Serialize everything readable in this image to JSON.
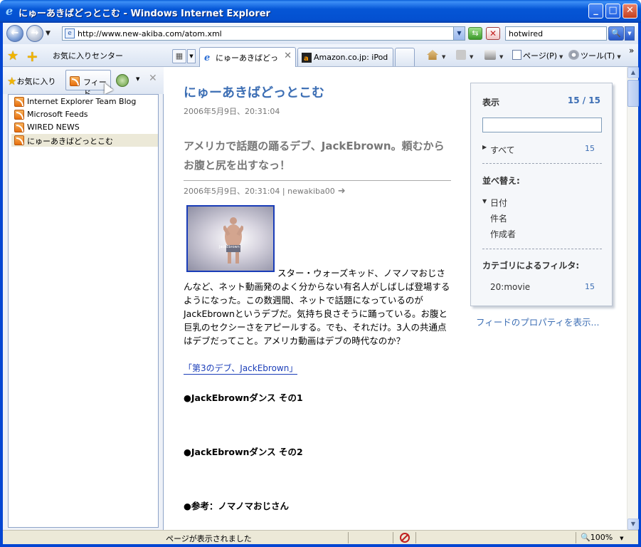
{
  "window": {
    "title": "にゅーあきばどっとこむ - Windows Internet Explorer"
  },
  "address_bar": {
    "url": "http://www.new-akiba.com/atom.xml",
    "search_value": "hotwired"
  },
  "toolbar": {
    "favorites_center": "お気に入りセンター",
    "tabs": [
      {
        "label": "にゅーあきばどっと..."
      },
      {
        "label": "Amazon.co.jp: iPod f..."
      }
    ],
    "page_menu": "ページ(P)",
    "tools_menu": "ツール(T)",
    "more": "»"
  },
  "favorites_pane": {
    "favorites_button": "お気に入り",
    "feeds_button": "フィード",
    "feeds": [
      {
        "label": "Internet Explorer Team Blog"
      },
      {
        "label": "Microsoft Feeds"
      },
      {
        "label": "WIRED NEWS"
      },
      {
        "label": "にゅーあきばどっとこむ"
      }
    ],
    "selected_index": 3
  },
  "feed": {
    "title": "にゅーあきばどっとこむ",
    "date": "2006年5月9日、20:31:04",
    "article": {
      "title": "アメリカで話題の踊るデブ、JackEbrown。頼むからお腹と尻を出すなっ！",
      "meta": "2006年5月9日、20:31:04 | newakiba00",
      "photo_caption": "JackEbrown",
      "body_first": "スター・ウォーズキッド、ノマノマおじ",
      "body_rest": "さんなど、ネット動画発のよく分からない有名人がしばしば登場するようになった。この数週間、ネットで話題になっているのがJackEbrownというデブだ。気持ち良さそうに踊っている。お腹と巨乳のセクシーさをアピールする。でも、それだけ。3人の共通点はデブだってこと。アメリカ動画はデブの時代なのか？",
      "link": "「第3のデブ、JackEbrown」",
      "bullets": [
        "●JackEbrownダンス その1",
        "●JackEbrownダンス その2",
        "●参考：ノマノマおじさん"
      ]
    }
  },
  "filter_panel": {
    "display_label": "表示",
    "display_count": "15 / 15",
    "all_label": "すべて",
    "all_count": "15",
    "sort_label": "並べ替え:",
    "sort_options": [
      "日付",
      "件名",
      "作成者"
    ],
    "category_label": "カテゴリによるフィルタ:",
    "category_item": "20:movie",
    "category_count": "15",
    "feed_properties": "フィードのプロパティを表示..."
  },
  "status": {
    "text": "ページが表示されました",
    "zoom": "100%"
  },
  "colors": {
    "accent": "#3c6eb4",
    "titlebar": "#0556d6"
  }
}
